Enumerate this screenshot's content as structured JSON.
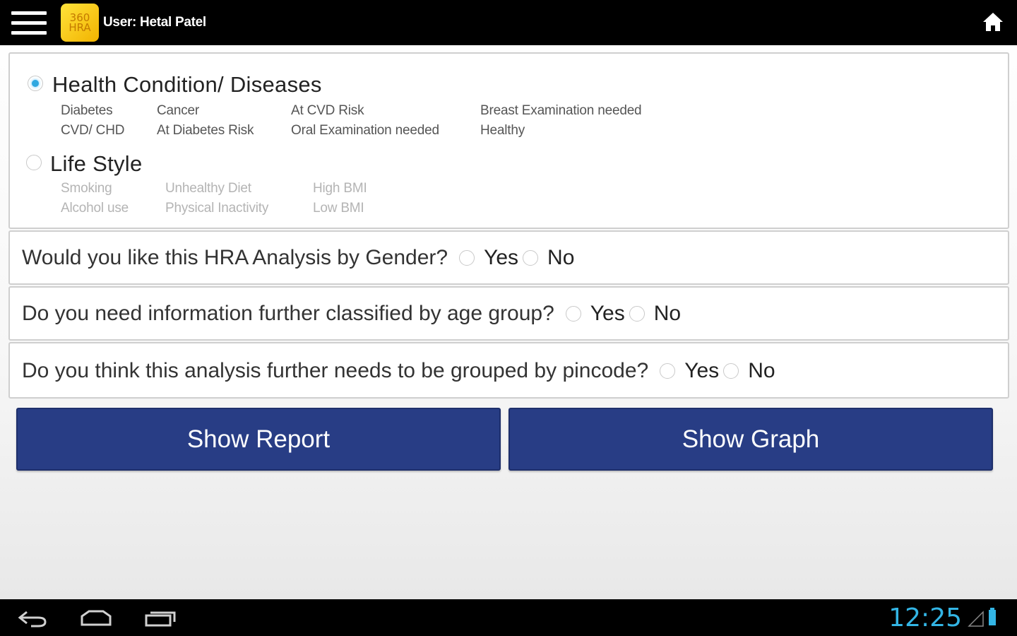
{
  "header": {
    "logo_line1": "360",
    "logo_line2": "HRA",
    "user_label": "User: Hetal Patel"
  },
  "filter": {
    "health": {
      "label": "Health Condition/ Diseases",
      "selected": true,
      "items": [
        "Diabetes",
        "Cancer",
        "At CVD Risk",
        "Breast Examination needed",
        "CVD/ CHD",
        "At Diabetes Risk",
        "Oral Examination needed",
        "Healthy"
      ]
    },
    "lifestyle": {
      "label": "Life Style",
      "selected": false,
      "items": [
        "Smoking",
        "Unhealthy Diet",
        "High BMI",
        "Alcohol use",
        "Physical Inactivity",
        "Low BMI"
      ]
    }
  },
  "questions": [
    {
      "text": "Would you like this HRA Analysis by Gender?",
      "yes": "Yes",
      "no": "No"
    },
    {
      "text": "Do you need information further classified by age group?",
      "yes": "Yes",
      "no": "No"
    },
    {
      "text": "Do you think this analysis further needs to be grouped by pincode?",
      "yes": "Yes",
      "no": "No"
    }
  ],
  "buttons": {
    "report": "Show Report",
    "graph": "Show Graph"
  },
  "status": {
    "time": "12:25"
  },
  "colors": {
    "button_bg": "#283d85",
    "clock": "#33b5e5",
    "radio_selected": "#2fa8e0"
  }
}
